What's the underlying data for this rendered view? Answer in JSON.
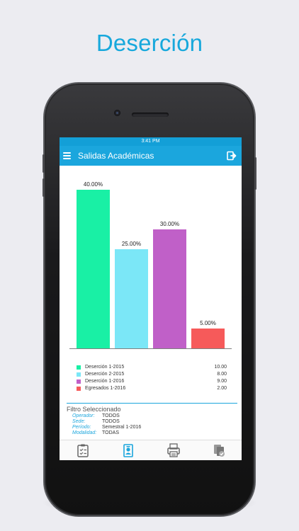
{
  "headline": "Deserción",
  "status": {
    "time": "3:41 PM"
  },
  "navbar": {
    "title": "Salidas Académicas",
    "menu_icon": "hamburger-menu-icon",
    "logout_icon": "logout-icon"
  },
  "chart_data": {
    "type": "bar",
    "categories": [
      "Deserción 1-2015",
      "Deserción 2-2015",
      "Deserción 1-2016",
      "Egresados 1-2016"
    ],
    "values": [
      40.0,
      25.0,
      30.0,
      5.0
    ],
    "data_labels": [
      "40.00%",
      "25.00%",
      "30.00%",
      "5.00%"
    ],
    "colors": [
      "#19f0a5",
      "#7be7f7",
      "#c060c8",
      "#f65a5a"
    ],
    "ylim": [
      0,
      40
    ],
    "grid": false,
    "legend_placement": "bottom"
  },
  "legend": {
    "items": [
      {
        "label": "Deserción 1-2015",
        "value": "10.00",
        "color": "#19f0a5"
      },
      {
        "label": "Deserción 2-2015",
        "value": "8.00",
        "color": "#7be7f7"
      },
      {
        "label": "Deserción 1-2016",
        "value": "9.00",
        "color": "#c060c8"
      },
      {
        "label": "Egresados 1-2016",
        "value": "2.00",
        "color": "#f65a5a"
      }
    ]
  },
  "filter": {
    "title": "Filtro Seleccionado",
    "rows": [
      {
        "key": "Operador:",
        "value": "TODOS"
      },
      {
        "key": "Sede:",
        "value": "TODOS"
      },
      {
        "key": "Período:",
        "value": "Semestral 1-2016"
      },
      {
        "key": "Modalidad:",
        "value": "TODAS"
      }
    ]
  },
  "tabbar": {
    "tabs": [
      {
        "icon": "clipboard-checklist-icon",
        "active": false
      },
      {
        "icon": "student-id-icon",
        "active": true
      },
      {
        "icon": "report-printer-icon",
        "active": false
      },
      {
        "icon": "documents-check-icon",
        "active": false
      }
    ]
  },
  "colors": {
    "accent": "#1ba6dd",
    "background": "#ececf1"
  }
}
